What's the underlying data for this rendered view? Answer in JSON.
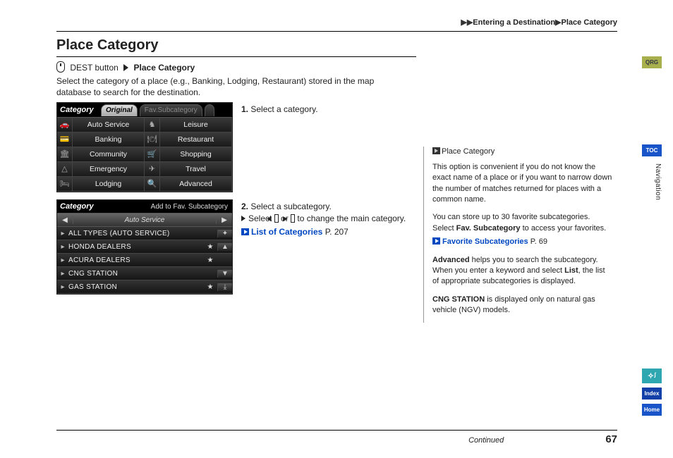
{
  "breadcrumb": {
    "a": "Entering a Destination",
    "b": "Place Category"
  },
  "title": "Place Category",
  "dest": {
    "btn": "DEST button",
    "target": "Place Category"
  },
  "intro": "Select the category of a place (e.g., Banking, Lodging, Restaurant) stored in the map database to search for the destination.",
  "screen1": {
    "header": "Category",
    "tab_active": "Original",
    "tab_inactive": "Fav.Subcategory",
    "tab_inactive2": "  ",
    "rows": [
      {
        "i1": "🚗",
        "n1": "Auto Service",
        "i2": "♞",
        "n2": "Leisure"
      },
      {
        "i1": "💳",
        "n1": "Banking",
        "i2": "🍽",
        "n2": "Restaurant"
      },
      {
        "i1": "🏛",
        "n1": "Community",
        "i2": "🛒",
        "n2": "Shopping"
      },
      {
        "i1": "△",
        "n1": "Emergency",
        "i2": "✈",
        "n2": "Travel"
      },
      {
        "i1": "🛏",
        "n1": "Lodging",
        "i2": "🔍",
        "n2": "Advanced"
      }
    ]
  },
  "step1": "Select a category.",
  "screen2": {
    "header": "Category",
    "right_label": "Add to Fav. Subcategory",
    "bar_title": "Auto Service",
    "rows": [
      {
        "label": "ALL TYPES (AUTO SERVICE)",
        "star": "",
        "scroll": "✦"
      },
      {
        "label": "HONDA DEALERS",
        "star": "★",
        "scroll": "▲"
      },
      {
        "label": "ACURA DEALERS",
        "star": "★",
        "scroll": ""
      },
      {
        "label": "CNG STATION",
        "star": "",
        "scroll": "▼"
      },
      {
        "label": "GAS STATION",
        "star": "★",
        "scroll": "⤓"
      }
    ]
  },
  "step2": {
    "head": "Select a subcategory.",
    "sub_a": "Select ",
    "key_l": "◀",
    "sub_b": " or ",
    "key_r": "▶",
    "sub_c": " to change the main category.",
    "link": "List of Categories",
    "link_page": "P. 207"
  },
  "right": {
    "title": "Place Category",
    "p1": "This option is convenient if you do not know the exact name of a place or if you want to narrow down the number of matches returned for places with a common name.",
    "p2a": "You can store up to 30 favorite subcategories. Select ",
    "p2b": "Fav. Subcategory",
    "p2c": " to access your favorites.",
    "link1": "Favorite Subcategories",
    "link1_page": "P. 69",
    "p3a": "Advanced",
    "p3b": " helps you to search the subcategory. When you enter a keyword and select ",
    "p3c": "List",
    "p3d": ", the list of appropriate subcategories is displayed.",
    "p4a": "CNG STATION",
    "p4b": " is displayed only on natural gas vehicle (NGV) models."
  },
  "side": {
    "qrg": "QRG",
    "toc": "TOC",
    "section": "Navigation",
    "voice": "✧ᶴ",
    "index": "Index",
    "home": "Home"
  },
  "footer": {
    "cont": "Continued",
    "page": "67"
  }
}
